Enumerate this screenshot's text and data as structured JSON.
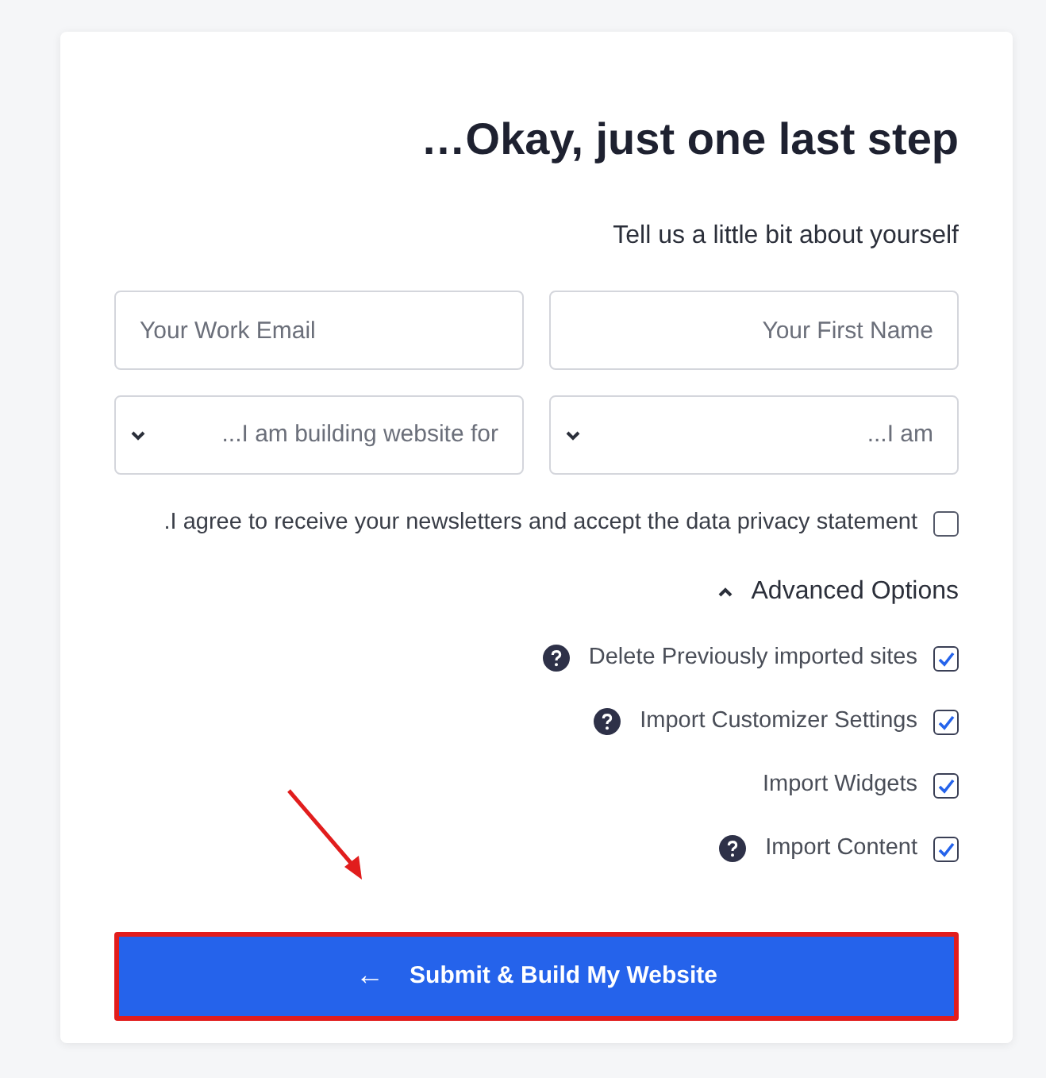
{
  "title": "…Okay, just one last step",
  "subtitle": "Tell us a little bit about yourself",
  "fields": [
    {
      "kind": "email",
      "placeholder": "Your Work Email"
    },
    {
      "kind": "text",
      "placeholder": "Your First Name"
    },
    {
      "kind": "select",
      "placeholder": "...I am building website for"
    },
    {
      "kind": "select",
      "placeholder": "...I am"
    }
  ],
  "consent": {
    "label": ".I agree to receive your newsletters and accept the data privacy statement",
    "checked": false
  },
  "advanced": {
    "label": "Advanced Options",
    "expanded": true,
    "options": [
      {
        "label": "Delete Previously imported sites",
        "help": true,
        "checked": true
      },
      {
        "label": "Import Customizer Settings",
        "help": true,
        "checked": true
      },
      {
        "label": "Import Widgets",
        "help": false,
        "checked": true
      },
      {
        "label": "Import Content",
        "help": true,
        "checked": true
      }
    ]
  },
  "submit": {
    "icon": "←",
    "label": "Submit & Build My Website",
    "highlighted": true
  }
}
